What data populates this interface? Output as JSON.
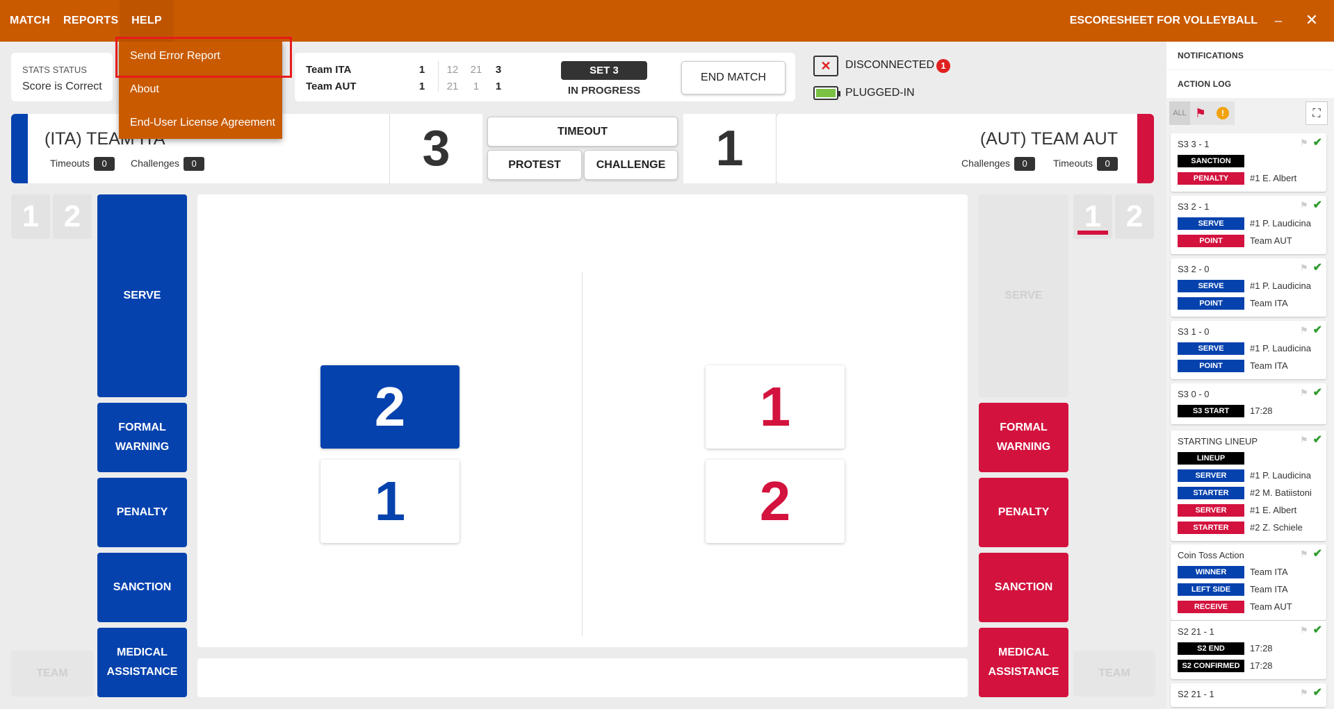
{
  "menu": {
    "match": "MATCH",
    "reports": "REPORTS",
    "help": "HELP"
  },
  "app_title": "ESCORESHEET FOR VOLLEYBALL",
  "window": {
    "minimize": "_",
    "close": "✕"
  },
  "help_menu": {
    "items": [
      "Send Error Report",
      "About",
      "End-User License Agreement"
    ],
    "highlighted": "Send Error Report"
  },
  "stats": {
    "label": "STATS STATUS",
    "value": "Score is Correct"
  },
  "scoreboard": {
    "teams": [
      {
        "name": "Team ITA",
        "sets": "1",
        "scores": [
          "12",
          "21",
          "3"
        ]
      },
      {
        "name": "Team AUT",
        "sets": "1",
        "scores": [
          "21",
          "1",
          "1"
        ]
      }
    ],
    "set_label": "SET 3",
    "status": "IN PROGRESS",
    "end_match": "END MATCH"
  },
  "connection": {
    "disconnected": "DISCONNECTED",
    "disconnected_count": "1",
    "plugged": "PLUGGED-IN"
  },
  "team_left": {
    "name": "(ITA) TEAM ITA",
    "timeouts_label": "Timeouts",
    "timeouts": "0",
    "challenges_label": "Challenges",
    "challenges": "0",
    "score": "3"
  },
  "team_right": {
    "name": "(AUT) TEAM AUT",
    "timeouts_label": "Timeouts",
    "timeouts": "0",
    "challenges_label": "Challenges",
    "challenges": "0",
    "score": "1"
  },
  "mid_buttons": {
    "timeout": "TIMEOUT",
    "protest": "PROTEST",
    "challenge": "CHALLENGE"
  },
  "rotation": {
    "left": [
      "1",
      "2"
    ],
    "right": [
      "1",
      "2"
    ]
  },
  "actions_left": {
    "serve": "SERVE",
    "formal_warning": "FORMAL WARNING",
    "penalty": "PENALTY",
    "sanction": "SANCTION",
    "medical": "MEDICAL ASSISTANCE",
    "team": "TEAM"
  },
  "actions_right": {
    "serve": "SERVE",
    "formal_warning": "FORMAL WARNING",
    "penalty": "PENALTY",
    "sanction": "SANCTION",
    "medical": "MEDICAL ASSISTANCE",
    "team": "TEAM"
  },
  "court": {
    "left_top": "2",
    "left_bottom": "1",
    "right_top": "1",
    "right_bottom": "2"
  },
  "colors": {
    "brand": "#c95a00",
    "team_left": "#0542ae",
    "team_right": "#d3123e"
  },
  "sidebar": {
    "notifications": "NOTIFICATIONS",
    "action_log": "ACTION LOG",
    "filters": {
      "all": "ALL",
      "flag_icon": "flag-icon",
      "warning_icon": "warning-icon",
      "warning_glyph": "!",
      "expand_icon": "expand-icon"
    },
    "log": [
      {
        "title": "S3  3 - 1",
        "rows": [
          {
            "tag": "SANCTION",
            "color": "black",
            "text": ""
          },
          {
            "tag": "PENALTY",
            "color": "red",
            "text": "#1 E. Albert"
          }
        ]
      },
      {
        "title": "S3  2 - 1",
        "rows": [
          {
            "tag": "SERVE",
            "color": "blue",
            "text": "#1 P. Laudicina"
          },
          {
            "tag": "POINT",
            "color": "red",
            "text": "Team AUT"
          }
        ]
      },
      {
        "title": "S3  2 - 0",
        "rows": [
          {
            "tag": "SERVE",
            "color": "blue",
            "text": "#1 P. Laudicina"
          },
          {
            "tag": "POINT",
            "color": "blue",
            "text": "Team ITA"
          }
        ]
      },
      {
        "title": "S3  1 - 0",
        "rows": [
          {
            "tag": "SERVE",
            "color": "blue",
            "text": "#1 P. Laudicina"
          },
          {
            "tag": "POINT",
            "color": "blue",
            "text": "Team ITA"
          }
        ]
      },
      {
        "title": "S3  0 - 0",
        "rows": [
          {
            "tag": "S3 START",
            "color": "black",
            "text": "17:28"
          }
        ]
      },
      {
        "title": "STARTING LINEUP",
        "rows": [
          {
            "tag": "LINEUP",
            "color": "black",
            "text": ""
          },
          {
            "tag": "SERVER",
            "color": "blue",
            "text": "#1 P. Laudicina"
          },
          {
            "tag": "STARTER",
            "color": "blue",
            "text": "#2 M. Batiistoni"
          },
          {
            "tag": "SERVER",
            "color": "red",
            "text": "#1 E. Albert"
          },
          {
            "tag": "STARTER",
            "color": "red",
            "text": "#2 Z. Schiele"
          }
        ]
      },
      {
        "title": "Coin Toss Action",
        "rows": [
          {
            "tag": "WINNER",
            "color": "blue",
            "text": "Team ITA"
          },
          {
            "tag": "LEFT SIDE",
            "color": "blue",
            "text": "Team ITA"
          },
          {
            "tag": "RECEIVE",
            "color": "red",
            "text": "Team AUT"
          }
        ]
      },
      {
        "title": "S2  21 - 1",
        "rows": [
          {
            "tag": "S2 END",
            "color": "black",
            "text": "17:28"
          },
          {
            "tag": "S2 CONFIRMED",
            "color": "black",
            "text": "17:28"
          }
        ]
      },
      {
        "title": "S2  21 - 1",
        "rows": []
      }
    ]
  }
}
